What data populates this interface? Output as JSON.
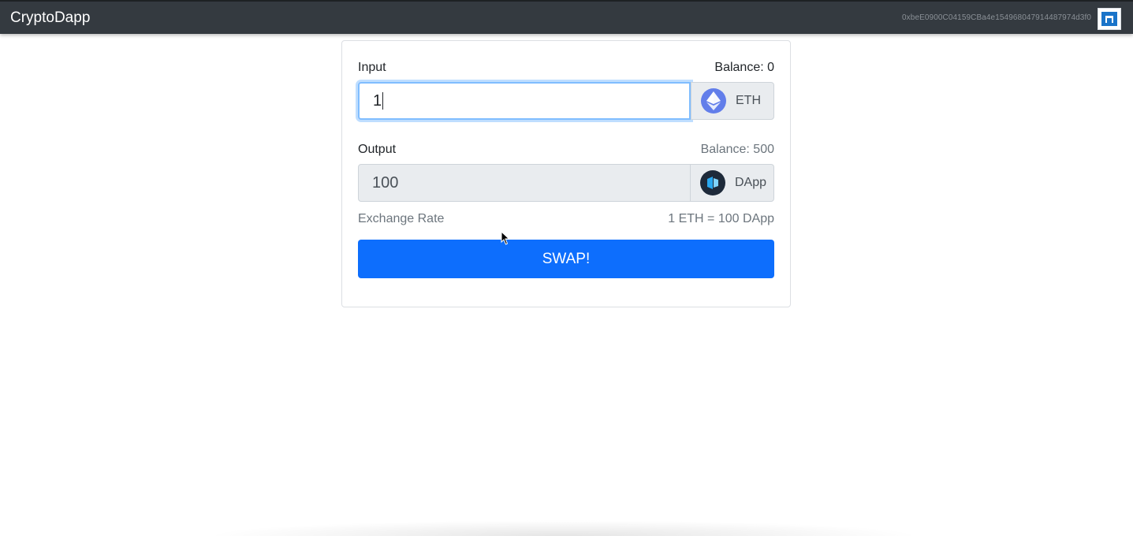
{
  "navbar": {
    "brand": "CryptoDapp",
    "account": "0xbeE0900C04159CBa4e154968047914487974d3f0"
  },
  "input": {
    "label": "Input",
    "balance": "Balance: 0",
    "value": "1",
    "token": "ETH",
    "token_icon": "ethereum-icon"
  },
  "output": {
    "label": "Output",
    "balance": "Balance: 500",
    "value": "100",
    "token": "DApp",
    "token_icon": "dapp-token-icon"
  },
  "exchange": {
    "label": "Exchange Rate",
    "rate": "1 ETH = 100 DApp"
  },
  "swap_button": "SWAP!",
  "colors": {
    "navbar": "#343a40",
    "primary": "#0d6efd",
    "eth": "#627eea"
  }
}
